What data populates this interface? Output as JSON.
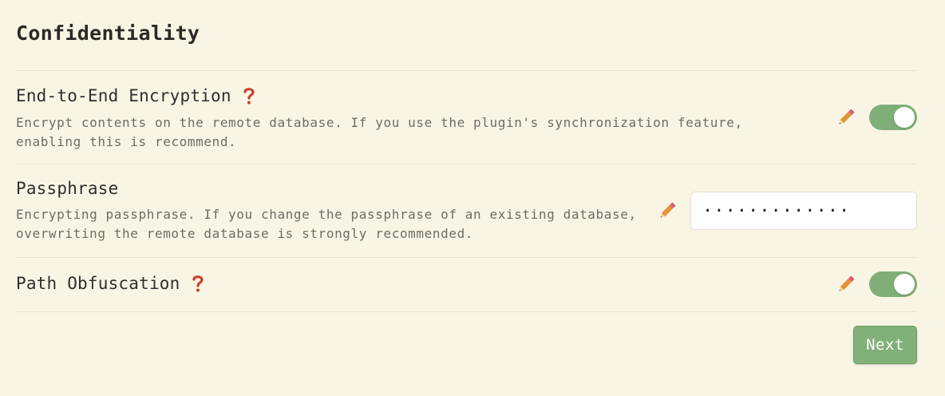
{
  "section": {
    "title": "Confidentiality"
  },
  "settings": {
    "encryption": {
      "name": "End-to-End Encryption",
      "description": "Encrypt contents on the remote database. If you use the plugin's synchronization feature, enabling this is recommend.",
      "enabled": true
    },
    "passphrase": {
      "name": "Passphrase",
      "description": "Encrypting passphrase. If you change the passphrase of an existing database, overwriting the remote database is strongly recommended.",
      "value": "·············"
    },
    "path_obfuscation": {
      "name": "Path Obfuscation",
      "enabled": true
    }
  },
  "actions": {
    "next_label": "Next"
  },
  "colors": {
    "background": "#f9f5e5",
    "toggle_on": "#7fae78",
    "button": "#81b179",
    "help": "#c9402a",
    "pencil": "#e38a3a"
  },
  "icons": [
    "help-icon",
    "pencil-icon"
  ]
}
